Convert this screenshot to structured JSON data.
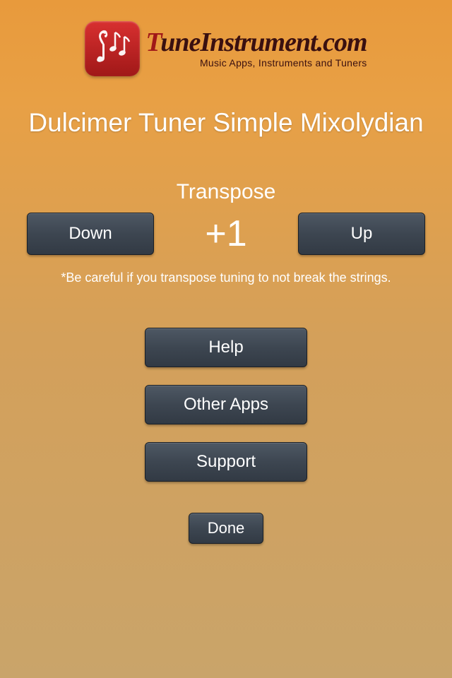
{
  "header": {
    "logo_title_red": "T",
    "logo_title_rest": "uneInstrument.com",
    "logo_subtitle": "Music Apps, Instruments and Tuners"
  },
  "page_title": "Dulcimer Tuner Simple Mixolydian",
  "transpose": {
    "label": "Transpose",
    "down_label": "Down",
    "up_label": "Up",
    "value": "+1",
    "warning": "*Be careful if you transpose tuning to not break the strings."
  },
  "menu": {
    "help_label": "Help",
    "other_apps_label": "Other Apps",
    "support_label": "Support"
  },
  "done_label": "Done"
}
